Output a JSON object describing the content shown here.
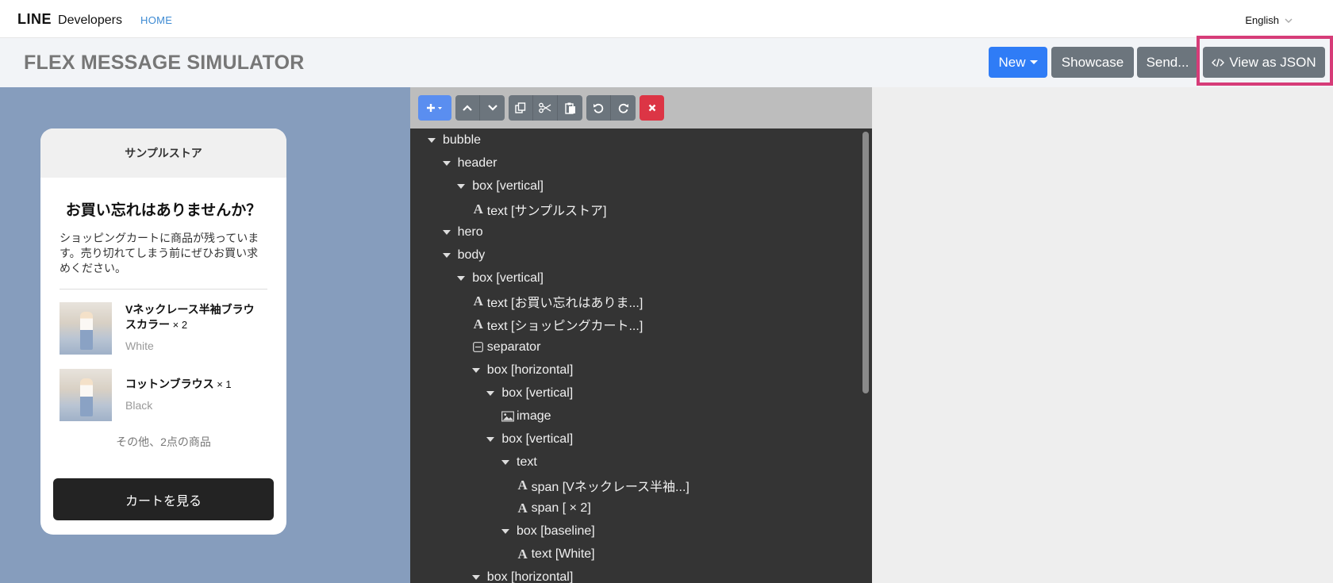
{
  "nav": {
    "brand_line": "LINE",
    "brand_developers": "Developers",
    "home": "HOME",
    "language": "English"
  },
  "titlebar": {
    "title": "FLEX MESSAGE SIMULATOR",
    "new_label": "New",
    "showcase_label": "Showcase",
    "send_label": "Send...",
    "view_json_label": "View as JSON"
  },
  "preview": {
    "header_text": "サンプルストア",
    "title": "お買い忘れはありませんか？",
    "description": "ショッピングカートに商品が残っています。売り切れてしまう前にぜひお買い求めください。",
    "items": [
      {
        "name": "Vネックレース半袖ブラウスカラー",
        "qty": " × 2",
        "color": "White"
      },
      {
        "name": "コットンブラウス",
        "qty": " × 1",
        "color": "Black"
      }
    ],
    "others": "その他、2点の商品",
    "cart_button": "カートを見る"
  },
  "tree": {
    "nodes": [
      {
        "label": "bubble",
        "indent": 0,
        "kind": "expand"
      },
      {
        "label": "header",
        "indent": 1,
        "kind": "expand"
      },
      {
        "label": "box [vertical]",
        "indent": 2,
        "kind": "expand"
      },
      {
        "label": "text [サンプルストア]",
        "indent": 3,
        "kind": "text"
      },
      {
        "label": "hero",
        "indent": 1,
        "kind": "expand"
      },
      {
        "label": "body",
        "indent": 1,
        "kind": "expand"
      },
      {
        "label": "box [vertical]",
        "indent": 2,
        "kind": "expand"
      },
      {
        "label": "text [お買い忘れはありま...]",
        "indent": 3,
        "kind": "text"
      },
      {
        "label": "text [ショッピングカート...]",
        "indent": 3,
        "kind": "text"
      },
      {
        "label": "separator",
        "indent": 3,
        "kind": "separator"
      },
      {
        "label": "box [horizontal]",
        "indent": 3,
        "kind": "expand"
      },
      {
        "label": "box [vertical]",
        "indent": 4,
        "kind": "expand"
      },
      {
        "label": "image",
        "indent": 5,
        "kind": "image"
      },
      {
        "label": "box [vertical]",
        "indent": 4,
        "kind": "expand"
      },
      {
        "label": "text",
        "indent": 5,
        "kind": "expand"
      },
      {
        "label": "span [Vネックレース半袖...]",
        "indent": 6,
        "kind": "text"
      },
      {
        "label": "span [ × 2]",
        "indent": 6,
        "kind": "text"
      },
      {
        "label": "box [baseline]",
        "indent": 5,
        "kind": "expand"
      },
      {
        "label": "text [White]",
        "indent": 6,
        "kind": "text"
      },
      {
        "label": "box [horizontal]",
        "indent": 3,
        "kind": "expand"
      }
    ]
  },
  "colors": {
    "primary": "#2f7cf6",
    "secondary": "#6c757d",
    "danger": "#dc3545",
    "highlight": "#d63c78",
    "preview_bg": "#869dbd",
    "tree_bg": "#343434"
  }
}
